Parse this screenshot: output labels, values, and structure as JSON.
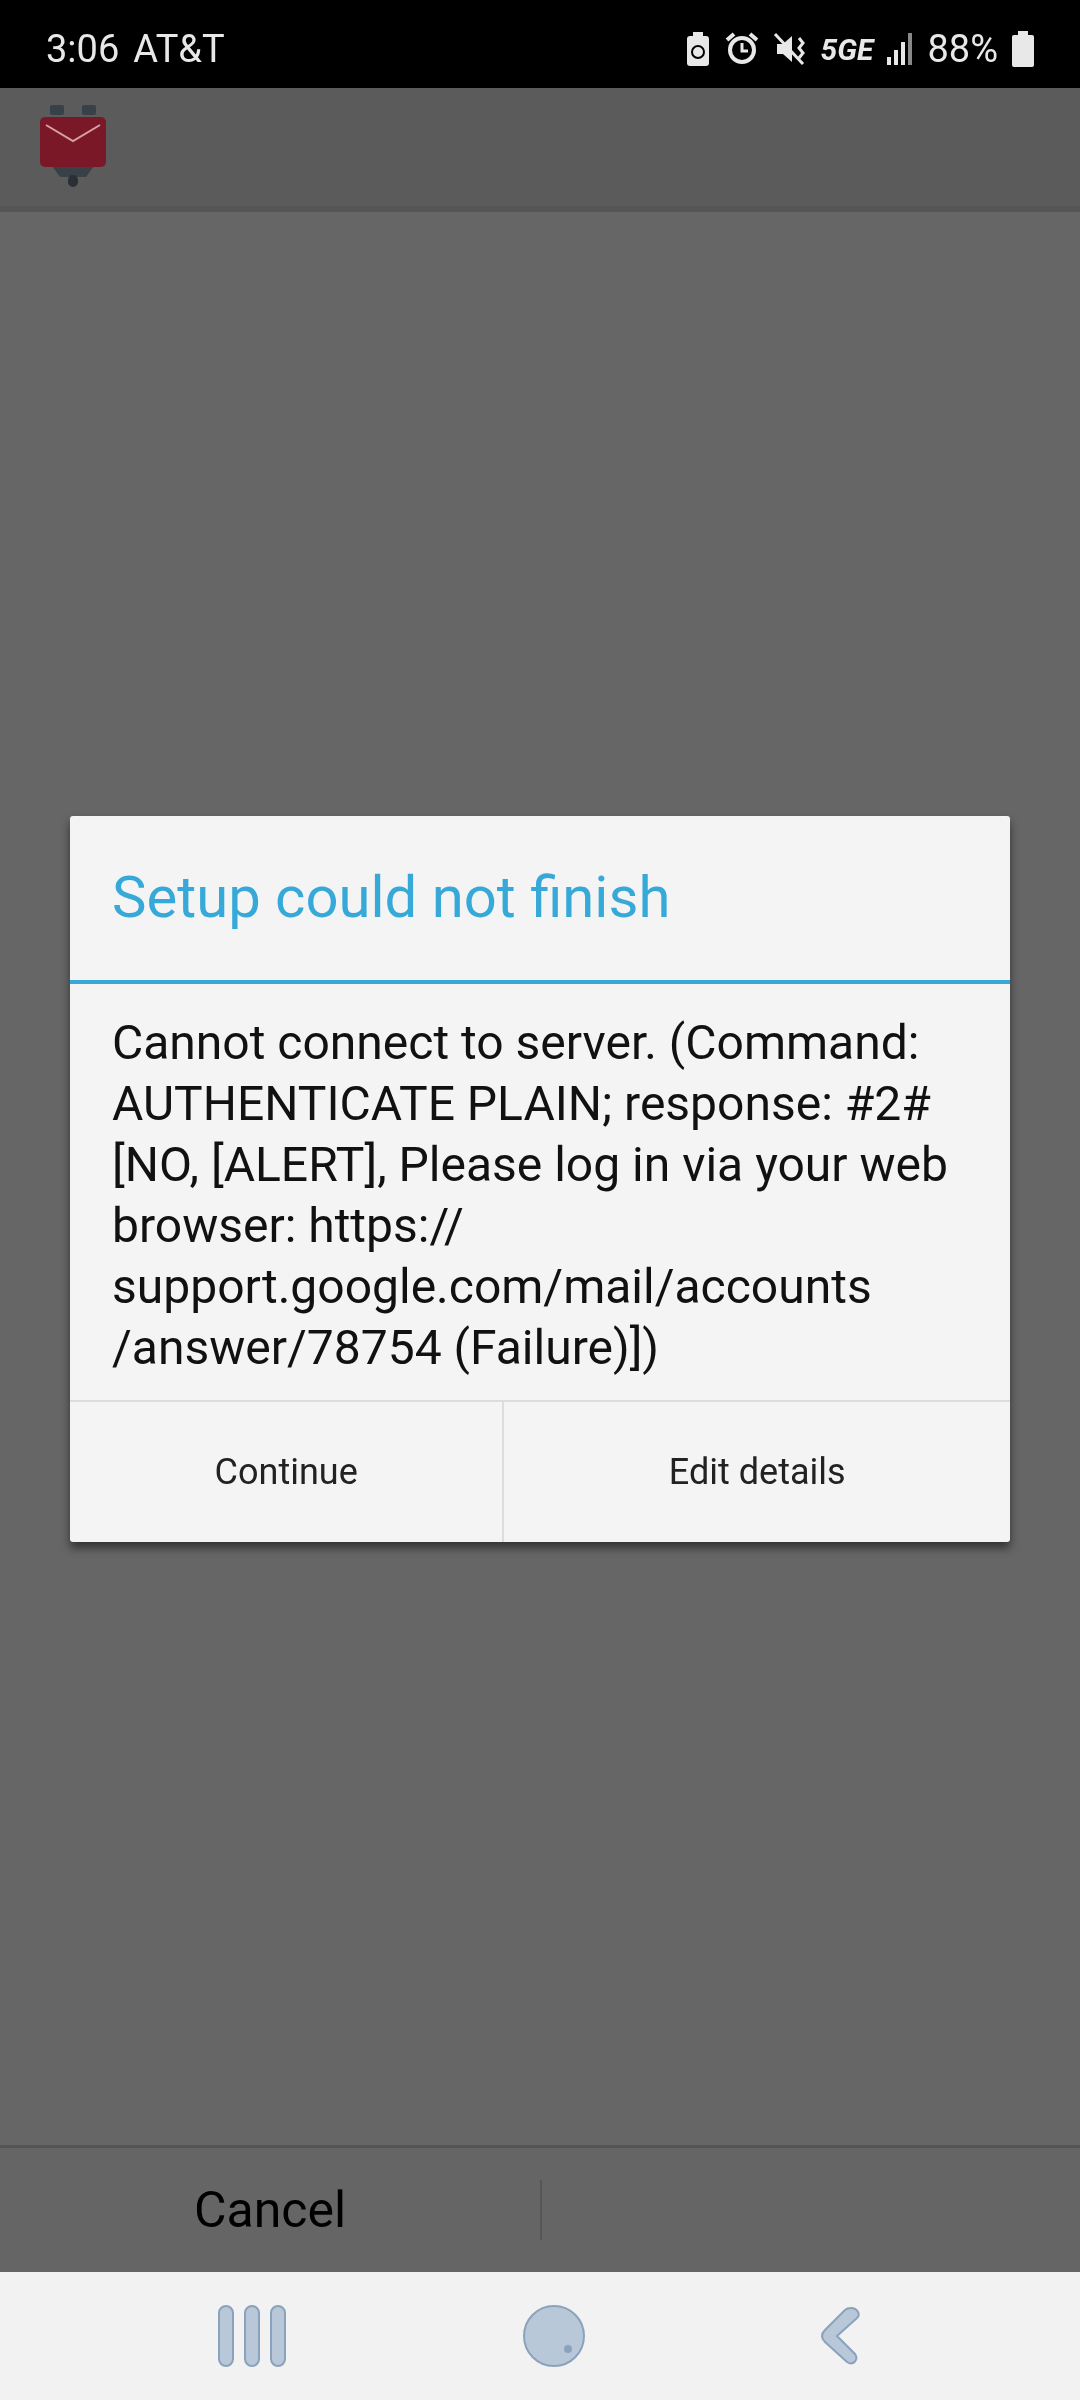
{
  "status_bar": {
    "time": "3:06",
    "carrier": "AT&T",
    "network": "5GE",
    "battery": "88%"
  },
  "dialog": {
    "title": "Setup could not finish",
    "message": "Cannot connect to server. (Command: AUTHENTICATE PLAIN; response: #2# [NO, [ALERT], Please log in via your web browser: https:// support.google.com/mail/accounts /answer/78754 (Failure)])",
    "buttons": [
      "Continue",
      "Edit details"
    ]
  },
  "bottom_bar": {
    "button": "Cancel"
  }
}
